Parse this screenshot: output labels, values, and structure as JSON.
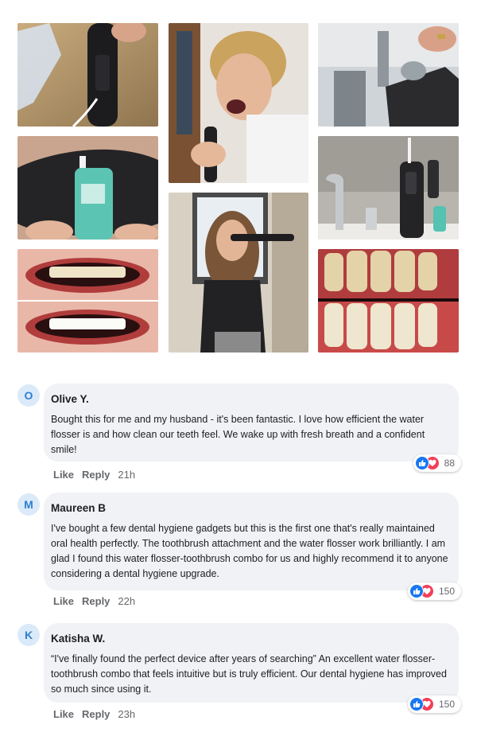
{
  "gallery": {
    "photos": [
      {
        "name": "photo-flosser-handheld",
        "alt": ""
      },
      {
        "name": "photo-woman-using-flosser",
        "alt": ""
      },
      {
        "name": "photo-flosser-refill",
        "alt": ""
      },
      {
        "name": "photo-mouthwash-bottle",
        "alt": ""
      },
      {
        "name": "photo-woman-brushing",
        "alt": ""
      },
      {
        "name": "photo-bathroom-sink",
        "alt": ""
      },
      {
        "name": "photo-teeth-before-after",
        "alt": ""
      },
      {
        "name": "photo-gums-before-after",
        "alt": ""
      }
    ]
  },
  "comments": [
    {
      "initial": "O",
      "author": "Olive Y.",
      "text": "Bought this for me and my husband - it's been fantastic. I love how efficient the water flosser is and how clean our teeth feel. We wake up with fresh breath and a confident smile!",
      "reactions": "88",
      "like": "Like",
      "reply": "Reply",
      "time": "21h"
    },
    {
      "initial": "M",
      "author": "Maureen B",
      "text": "I've bought a few dental hygiene gadgets but this is the first one that's really maintained oral health perfectly. The toothbrush attachment and the water flosser work brilliantly. I am glad I found this water flosser-toothbrush combo for us and highly recommend it to anyone considering a dental hygiene upgrade.",
      "reactions": "150",
      "like": "Like",
      "reply": "Reply",
      "time": "22h"
    },
    {
      "initial": "K",
      "author": "Katisha W.",
      "text": "“I've finally found the perfect device after years of searching” An excellent water flosser-toothbrush combo that feels intuitive but is truly efficient. Our dental hygiene has improved so much since using it.",
      "reactions": "150",
      "like": "Like",
      "reply": "Reply",
      "time": "23h"
    }
  ],
  "colors": {
    "bubble": "#f0f2f5",
    "like": "#1877f2",
    "love": "#f33e58",
    "meta": "#65676b",
    "avatar_bg": "#dbeaf8",
    "avatar_text": "#2f7fd0"
  }
}
